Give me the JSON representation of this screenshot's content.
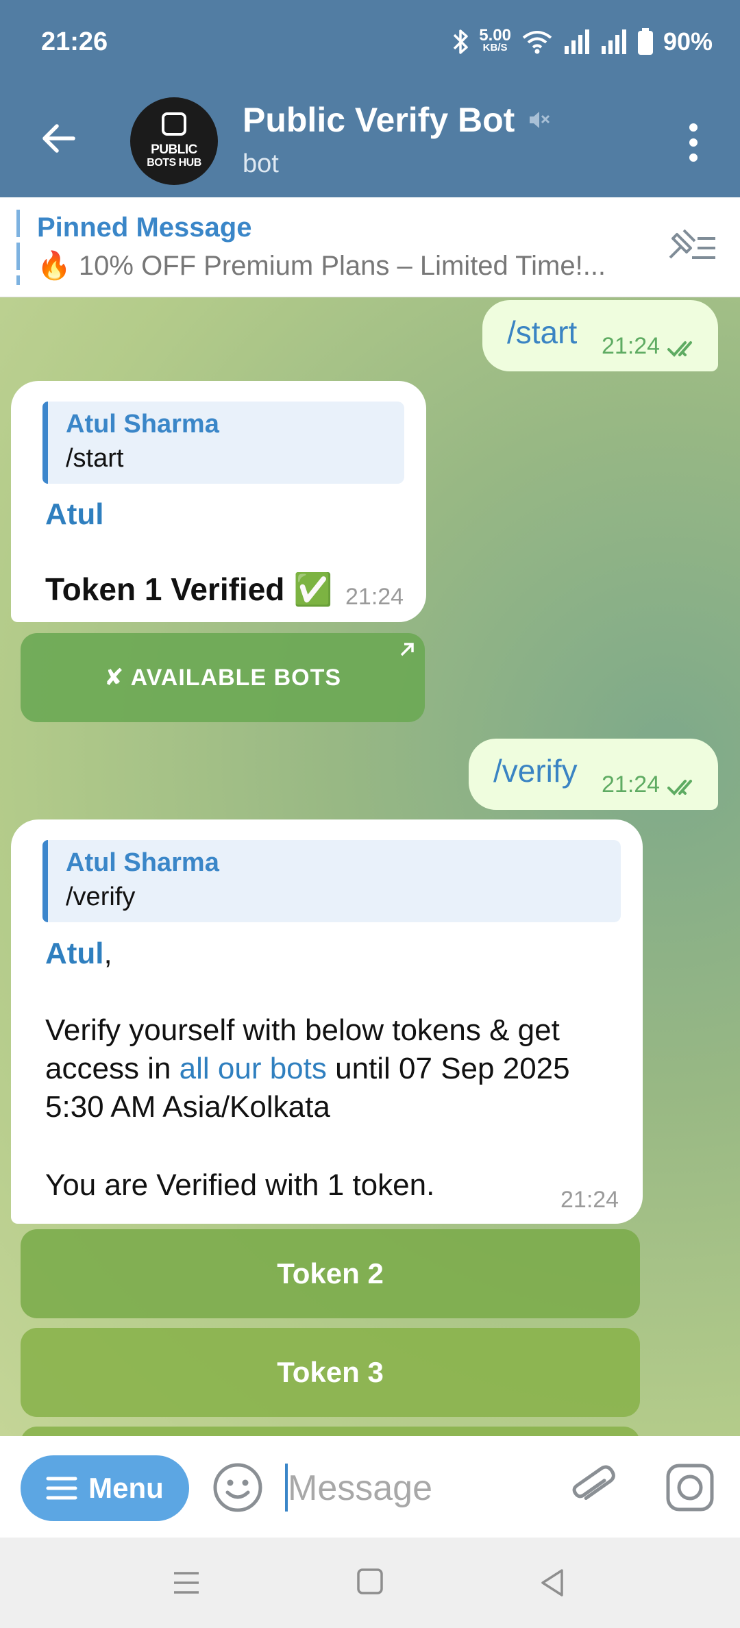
{
  "status_bar": {
    "time": "21:26",
    "net_speed_value": "5.00",
    "net_speed_unit": "KB/S",
    "battery": "90%"
  },
  "header": {
    "title": "Public Verify Bot",
    "subtitle": "bot",
    "avatar_line1": "PUBLIC",
    "avatar_line2": "BOTS HUB"
  },
  "pinned": {
    "title": "Pinned Message",
    "text": "🔥 10% OFF Premium Plans – Limited Time!..."
  },
  "messages": {
    "m1": {
      "text": "/start",
      "time": "21:24"
    },
    "m2": {
      "quote_name": "Atul Sharma",
      "quote_text": "/start",
      "name": "Atul",
      "body": "Token 1 Verified ✅",
      "time": "21:24"
    },
    "m2_button": {
      "label": "✘ AVAILABLE BOTS"
    },
    "m3": {
      "text": "/verify",
      "time": "21:24"
    },
    "m4": {
      "quote_name": "Atul Sharma",
      "quote_text": "/verify",
      "name": "Atul",
      "name_suffix": ",",
      "line1": "Verify yourself with below tokens & get",
      "line2_pre": "access in ",
      "line2_link": "all our bots",
      "line2_post": " until 07 Sep 2025",
      "line3": "5:30 AM Asia/Kolkata",
      "line4": "You are Verified with 1 token.",
      "time": "21:24"
    },
    "buttons": [
      {
        "label": "Token 2"
      },
      {
        "label": "Token 3"
      }
    ]
  },
  "input": {
    "menu_label": "Menu",
    "placeholder": "Message"
  },
  "colors": {
    "header_bg": "#527da3",
    "accent": "#3a86c8",
    "outgoing_bubble": "#effdde",
    "button_green": "#6ea550"
  }
}
